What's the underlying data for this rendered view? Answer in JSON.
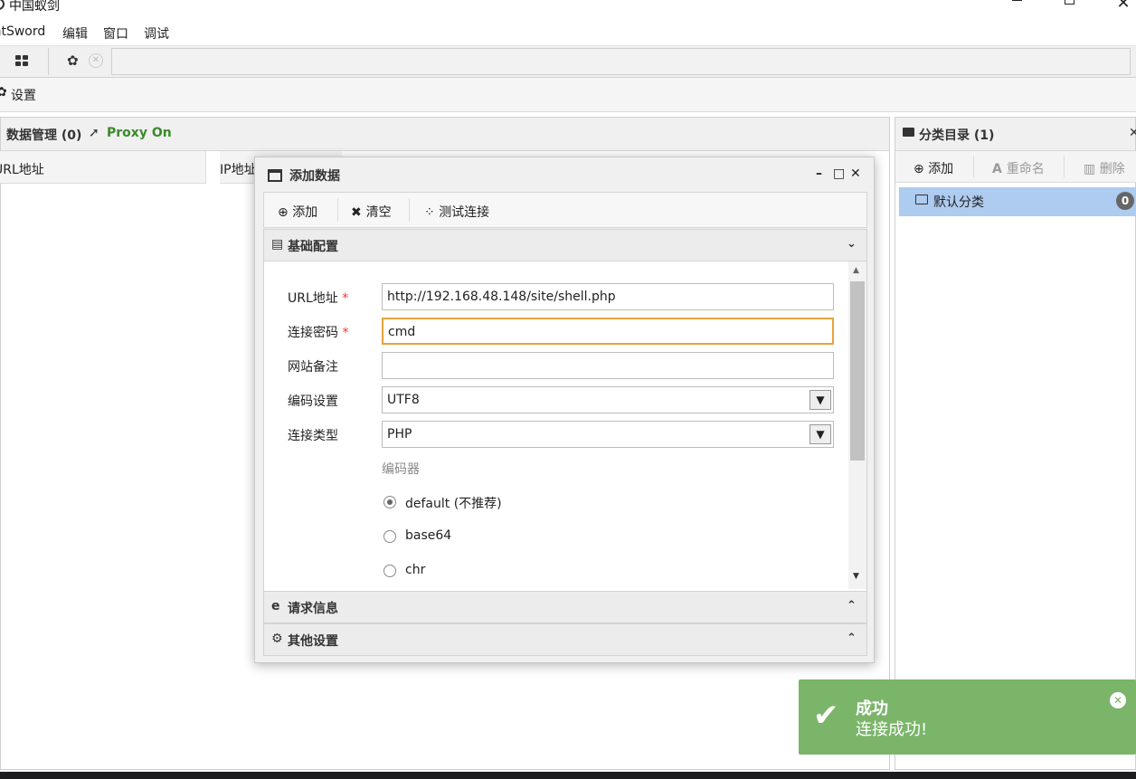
{
  "window": {
    "title": "中国蚁剑",
    "min_glyph": "—",
    "max_glyph": "□",
    "close_glyph": "✕"
  },
  "menu": {
    "items": [
      "AntSword",
      "编辑",
      "窗口",
      "调试"
    ]
  },
  "tabs": {
    "settings_close": "✕"
  },
  "settings_bar": {
    "label": "设置"
  },
  "data_panel": {
    "title": "数据管理 (0)",
    "proxy_status": "Proxy On",
    "columns": [
      "URL地址",
      "IP地址"
    ]
  },
  "category_panel": {
    "title": "分类目录 (1)",
    "close": "✕",
    "toolbar": {
      "add": "添加",
      "rename": "重命名",
      "delete": "删除"
    },
    "categories": [
      {
        "name": "默认分类",
        "count": "0"
      }
    ]
  },
  "dialog": {
    "title": "添加数据",
    "toolbar": {
      "add": "添加",
      "clear": "清空",
      "test": "测试连接"
    },
    "sections": {
      "basic": "基础配置",
      "request": "请求信息",
      "other": "其他设置"
    },
    "form": {
      "url_label": "URL地址",
      "url_value": "http://192.168.48.148/site/shell.php",
      "password_label": "连接密码",
      "password_value": "cmd",
      "note_label": "网站备注",
      "note_value": "",
      "encoding_label": "编码设置",
      "encoding_value": "UTF8",
      "type_label": "连接类型",
      "type_value": "PHP",
      "encoder_label": "编码器",
      "encoders": [
        {
          "label": "default (不推荐)",
          "checked": true
        },
        {
          "label": "base64",
          "checked": false
        },
        {
          "label": "chr",
          "checked": false
        }
      ],
      "required_mark": "*"
    }
  },
  "toast": {
    "title": "成功",
    "message": "连接成功!",
    "color": "#7bb56a"
  }
}
